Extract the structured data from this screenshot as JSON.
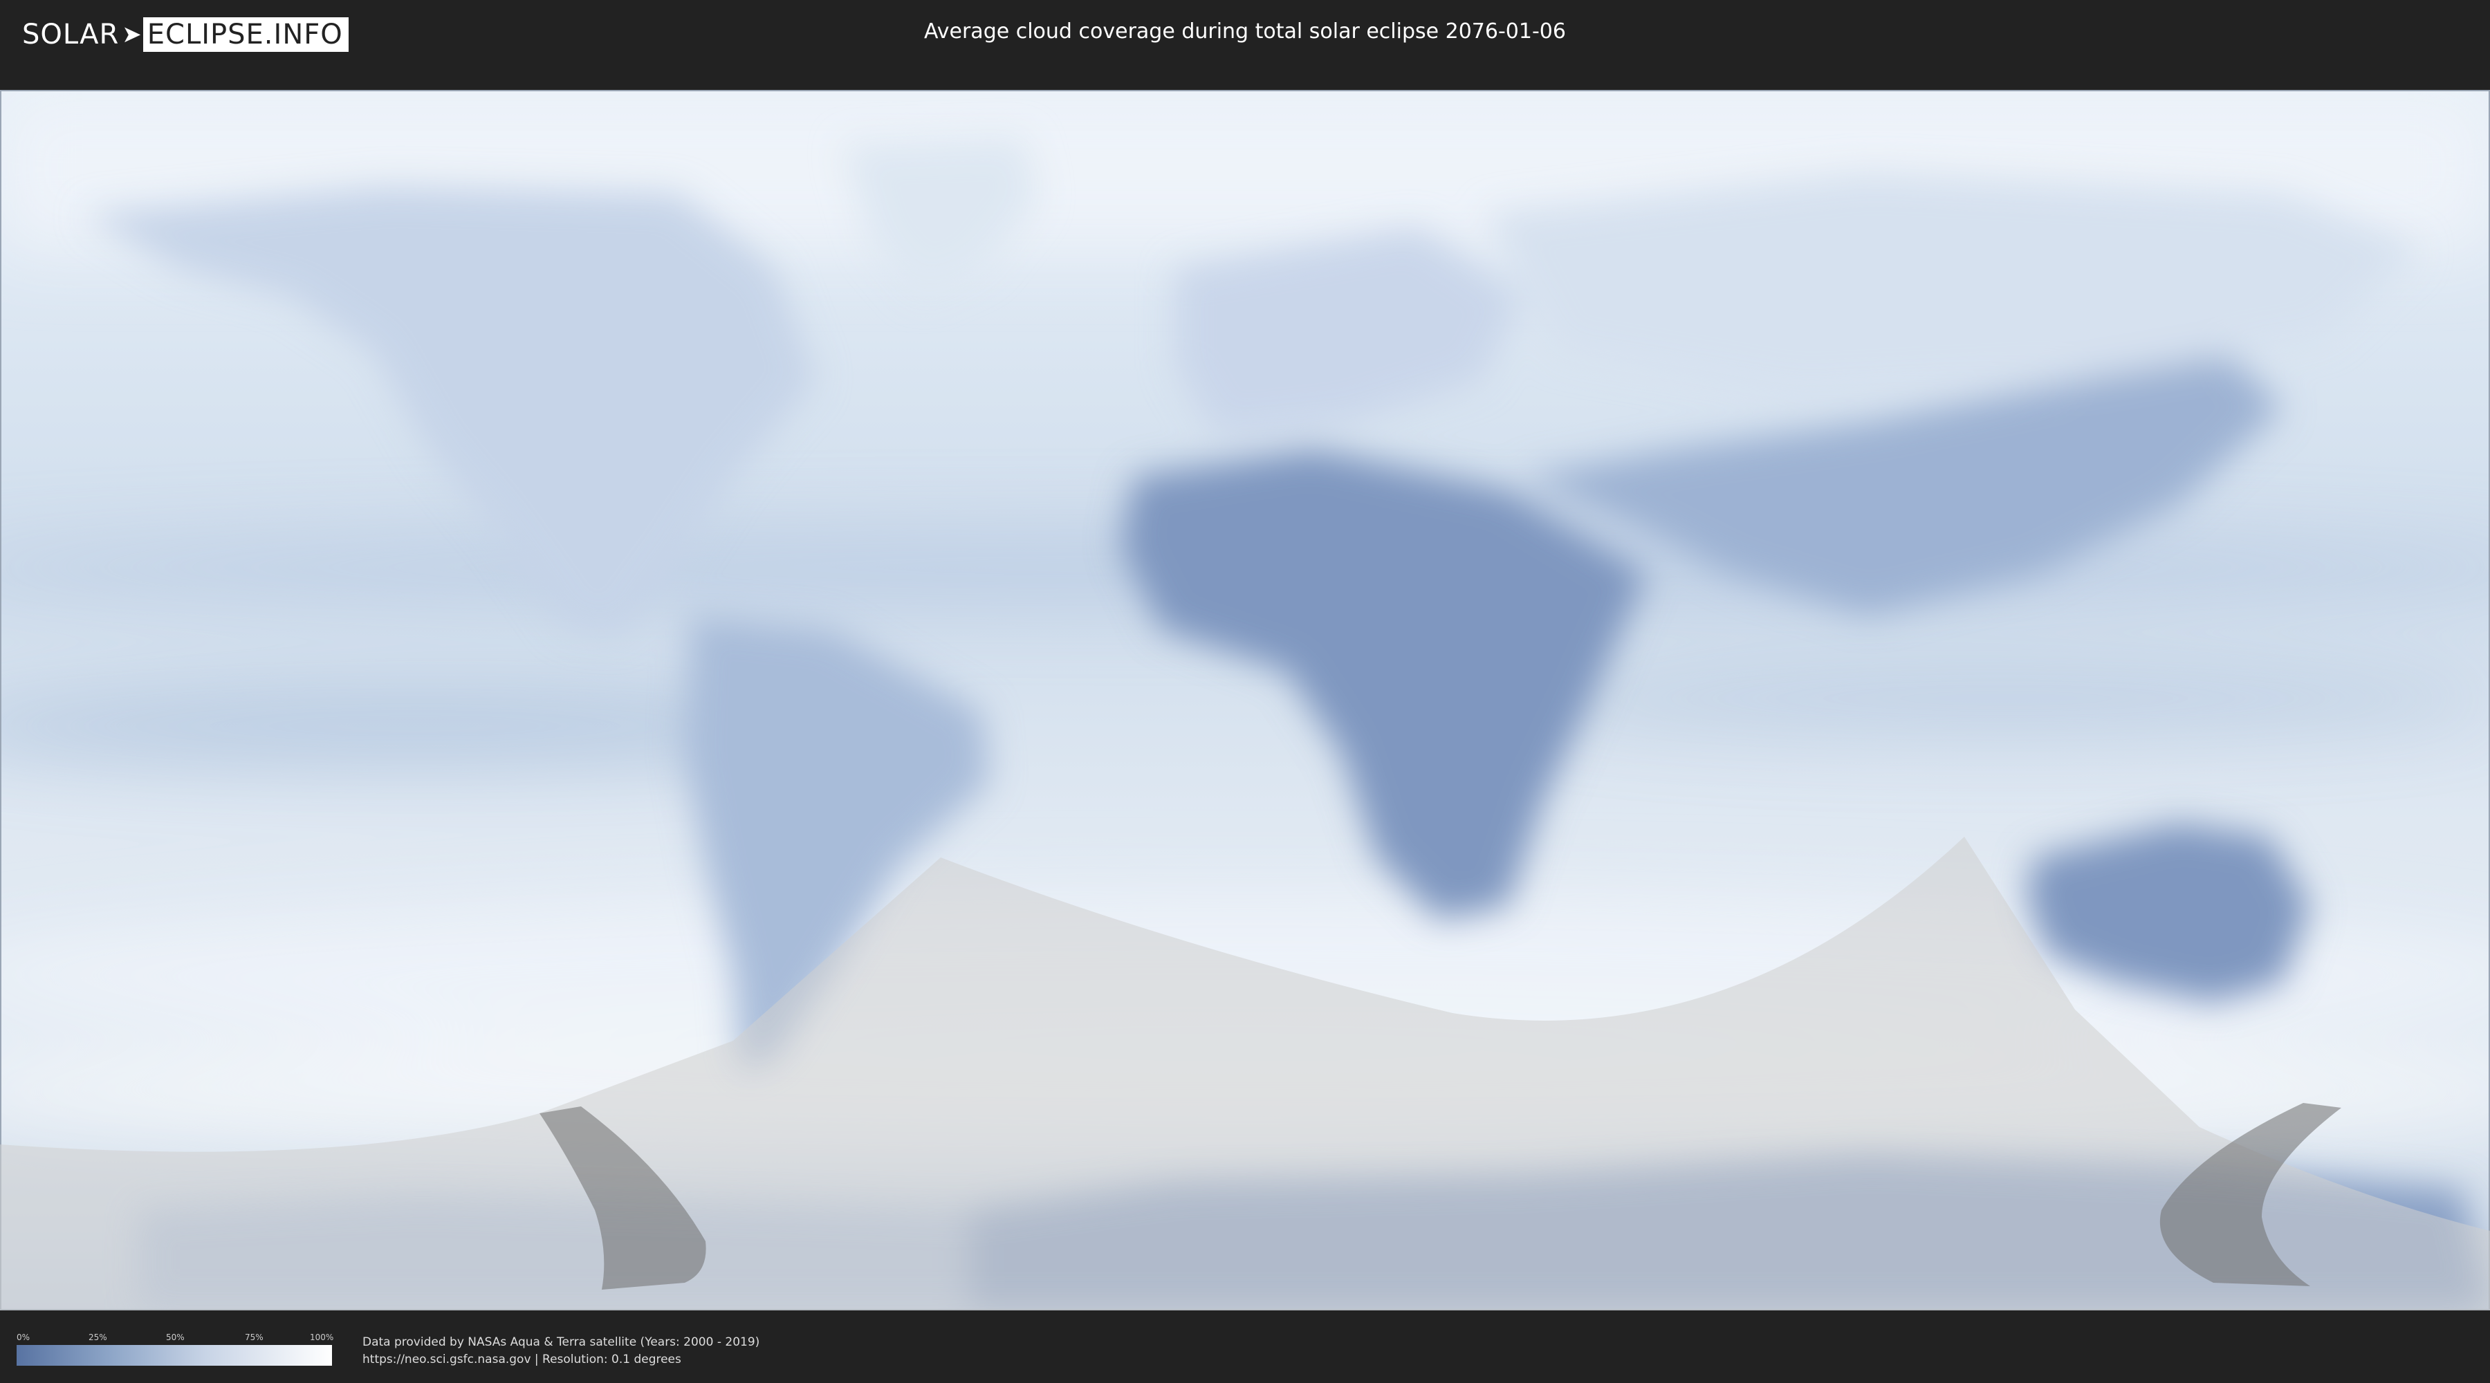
{
  "header": {
    "logo_solar": "SOLAR",
    "logo_info": "ECLIPSE.INFO",
    "title": "Average cloud coverage during total solar eclipse 2076-01-06"
  },
  "legend": {
    "ticks": [
      "0%",
      "25%",
      "50%",
      "75%",
      "100%"
    ],
    "colors": {
      "low": "#5873a2",
      "high": "#ffffff"
    }
  },
  "credits": {
    "line1": "Data provided by NASAs Aqua & Terra satellite (Years: 2000 - 2019)",
    "line2": "https://neo.sci.gsfc.nasa.gov | Resolution: 0.1 degrees"
  },
  "colors": {
    "background": "#222222",
    "land_clear": "#6f88b3",
    "cloudy": "#e6eef7",
    "eclipse_overlay": "#d8d8d8",
    "totality_path": "#7a7a7a"
  }
}
